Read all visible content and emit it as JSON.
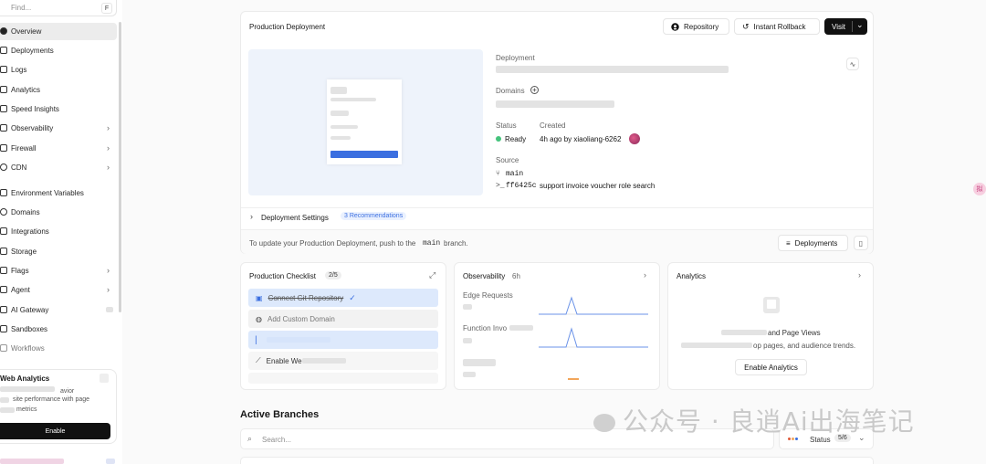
{
  "sidebar": {
    "find_placeholder": "Find...",
    "find_shortcut": "F",
    "items": [
      {
        "label": "Overview",
        "active": true,
        "chevron": false
      },
      {
        "label": "Deployments",
        "chevron": false
      },
      {
        "label": "Logs",
        "chevron": false
      },
      {
        "label": "Analytics",
        "chevron": false
      },
      {
        "label": "Speed Insights",
        "chevron": false
      },
      {
        "label": "Observability",
        "chevron": true
      },
      {
        "label": "Firewall",
        "chevron": true
      },
      {
        "label": "CDN",
        "chevron": true
      },
      {
        "label": "Environment Variables",
        "chevron": false
      },
      {
        "label": "Domains",
        "chevron": false
      },
      {
        "label": "Integrations",
        "chevron": false
      },
      {
        "label": "Storage",
        "chevron": false
      },
      {
        "label": "Flags",
        "chevron": true
      },
      {
        "label": "Agent",
        "chevron": true
      },
      {
        "label": "AI Gateway",
        "chevron": false
      },
      {
        "label": "Sandboxes",
        "chevron": false
      },
      {
        "label": "Workflows",
        "chevron": false
      }
    ],
    "web_analytics": {
      "title": "Web Analytics",
      "desc_line1": "avior",
      "desc_line2": "site performance with page",
      "desc_line3": "metrics",
      "button": "Enable"
    }
  },
  "production": {
    "title": "Production Deployment",
    "repository_label": "Repository",
    "rollback_label": "Instant Rollback",
    "visit_label": "Visit",
    "deployment_label": "Deployment",
    "domains_label": "Domains",
    "status_label": "Status",
    "status_value": "Ready",
    "created_label": "Created",
    "created_value": "4h ago by xiaoliang-6262",
    "source_label": "Source",
    "branch": "main",
    "commit_hash": "ff6425c",
    "commit_message": "support invoice voucher role search",
    "settings_label": "Deployment Settings",
    "recommendations": "3 Recommendations",
    "footer_text_pre": "To update your Production Deployment, push to the",
    "footer_branch": "main",
    "footer_text_post": "branch.",
    "deployments_button": "Deployments"
  },
  "checklist": {
    "title": "Production Checklist",
    "count": "2/5",
    "items": [
      "Connect Git Repository",
      "Add Custom Domain",
      "",
      "Enable We"
    ]
  },
  "observability": {
    "title": "Observability",
    "period": "6h",
    "row1": "Edge Requests",
    "row2": "Function Invo"
  },
  "analytics": {
    "title": "Analytics",
    "headline": "and Page Views",
    "sub": "op pages, and audience trends.",
    "button": "Enable Analytics"
  },
  "branches": {
    "title": "Active Branches",
    "search_placeholder": "Search...",
    "status_label": "Status",
    "status_count": "5/6"
  },
  "watermark": "公众号 · 良逍Ai出海笔记",
  "colors": {
    "ready": "#45c37c",
    "accent_blue": "#3b6fe0",
    "pill_bg": "#eaf1ff"
  }
}
